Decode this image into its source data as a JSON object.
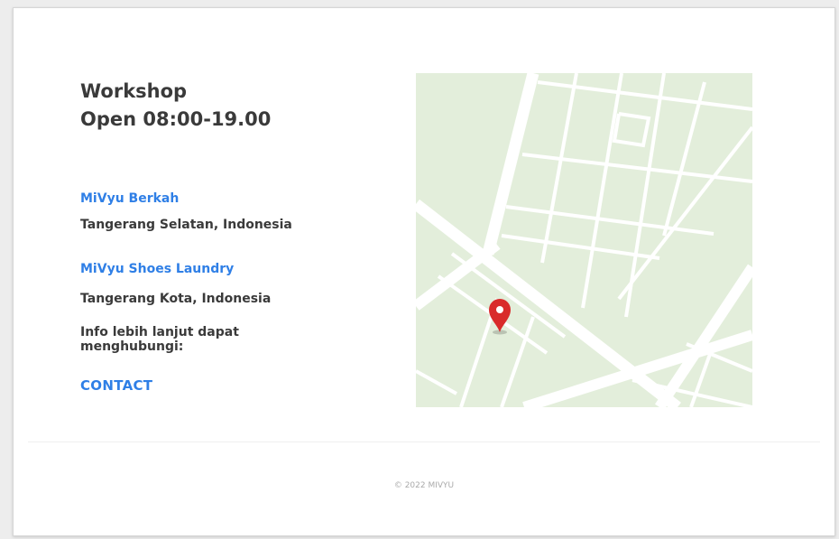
{
  "workshop": {
    "title_line1": "Workshop",
    "title_line2": "Open 08:00-19.00"
  },
  "locations": [
    {
      "name": "MiVyu Berkah",
      "address": "Tangerang Selatan, Indonesia"
    },
    {
      "name": "MiVyu Shoes Laundry",
      "address": "Tangerang Kota, Indonesia"
    }
  ],
  "contact": {
    "prompt": "Info lebih lanjut dapat menghubungi:",
    "link_label": "CONTACT"
  },
  "map": {
    "marker_icon": "map-pin-icon",
    "colors": {
      "land": "#e3eedb",
      "road": "#ffffff",
      "marker": "#d92b2b"
    }
  },
  "footer": {
    "copyright": "© 2022 MIVYU"
  },
  "colors": {
    "link": "#2f7fe6",
    "text": "#3a3a3a"
  }
}
